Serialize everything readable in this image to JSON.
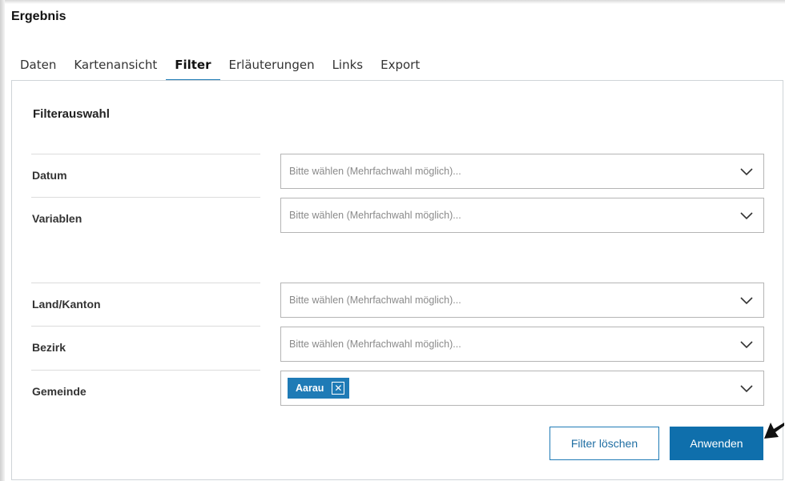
{
  "panel": {
    "title": "Ergebnis"
  },
  "tabs": [
    {
      "label": "Daten"
    },
    {
      "label": "Kartenansicht"
    },
    {
      "label": "Filter"
    },
    {
      "label": "Erläuterungen"
    },
    {
      "label": "Links"
    },
    {
      "label": "Export"
    }
  ],
  "active_tab": "Filter",
  "filter": {
    "section_title": "Filterauswahl",
    "fields": [
      {
        "label": "Datum",
        "placeholder": "Bitte wählen (Mehrfachwahl möglich)..."
      },
      {
        "label": "Variablen",
        "placeholder": "Bitte wählen (Mehrfachwahl möglich)..."
      },
      {
        "label": "Land/Kanton",
        "placeholder": "Bitte wählen (Mehrfachwahl möglich)..."
      },
      {
        "label": "Bezirk",
        "placeholder": "Bitte wählen (Mehrfachwahl möglich)..."
      },
      {
        "label": "Gemeinde",
        "selected": [
          "Aarau"
        ],
        "remove_glyph": "✕"
      }
    ],
    "clear_label": "Filter löschen",
    "apply_label": "Anwenden"
  },
  "icons": {
    "dropdown": "chevron-down-icon",
    "pointer": "arrow-pointer-icon",
    "tag_remove": "close-icon"
  },
  "colors": {
    "accent": "#1f7bb6",
    "primary_button": "#0f6fac",
    "border": "#b5b5b5"
  }
}
